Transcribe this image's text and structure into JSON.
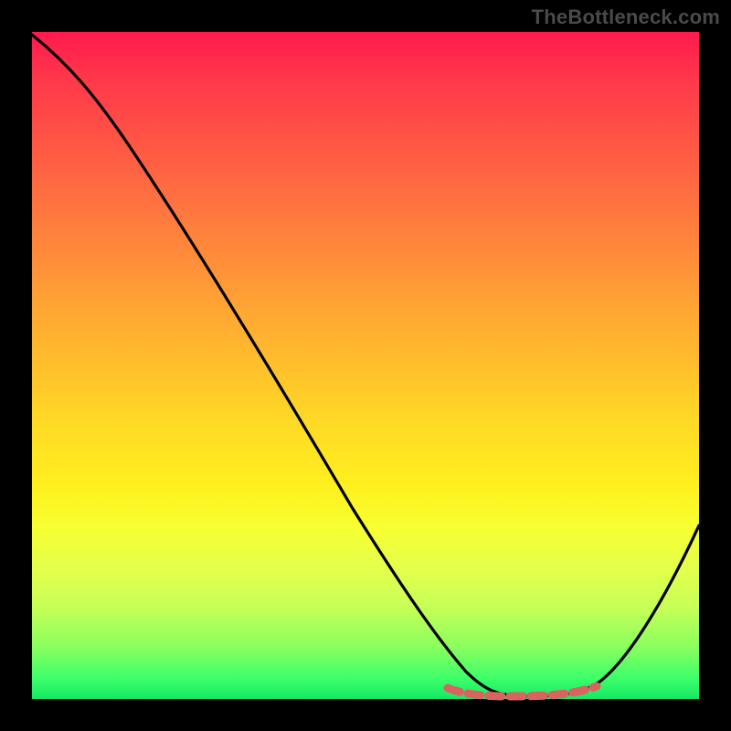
{
  "watermark": "TheBottleneck.com",
  "chart_data": {
    "type": "line",
    "title": "",
    "xlabel": "",
    "ylabel": "",
    "xlim": [
      0,
      100
    ],
    "ylim": [
      0,
      100
    ],
    "grid": false,
    "legend": false,
    "background_gradient": {
      "direction": "vertical",
      "stops": [
        {
          "pos": 0,
          "color": "#ff1a4d"
        },
        {
          "pos": 50,
          "color": "#ffc82a"
        },
        {
          "pos": 80,
          "color": "#f4ff3c"
        },
        {
          "pos": 100,
          "color": "#15e865"
        }
      ]
    },
    "series": [
      {
        "name": "bottleneck-curve",
        "color": "#000000",
        "x": [
          0,
          5,
          10,
          15,
          20,
          25,
          30,
          35,
          40,
          45,
          50,
          55,
          60,
          63,
          66,
          70,
          74,
          78,
          82,
          85,
          88,
          92,
          96,
          100
        ],
        "y": [
          100,
          96,
          91,
          85,
          78,
          71,
          63,
          55,
          47,
          39,
          31,
          23,
          15,
          10,
          6,
          3,
          1,
          0,
          0,
          1,
          4,
          10,
          18,
          28
        ]
      },
      {
        "name": "valley-marker",
        "color": "#d9645f",
        "style": "dashed",
        "x": [
          62,
          85
        ],
        "y": [
          1.5,
          1.5
        ]
      }
    ],
    "annotations": []
  }
}
